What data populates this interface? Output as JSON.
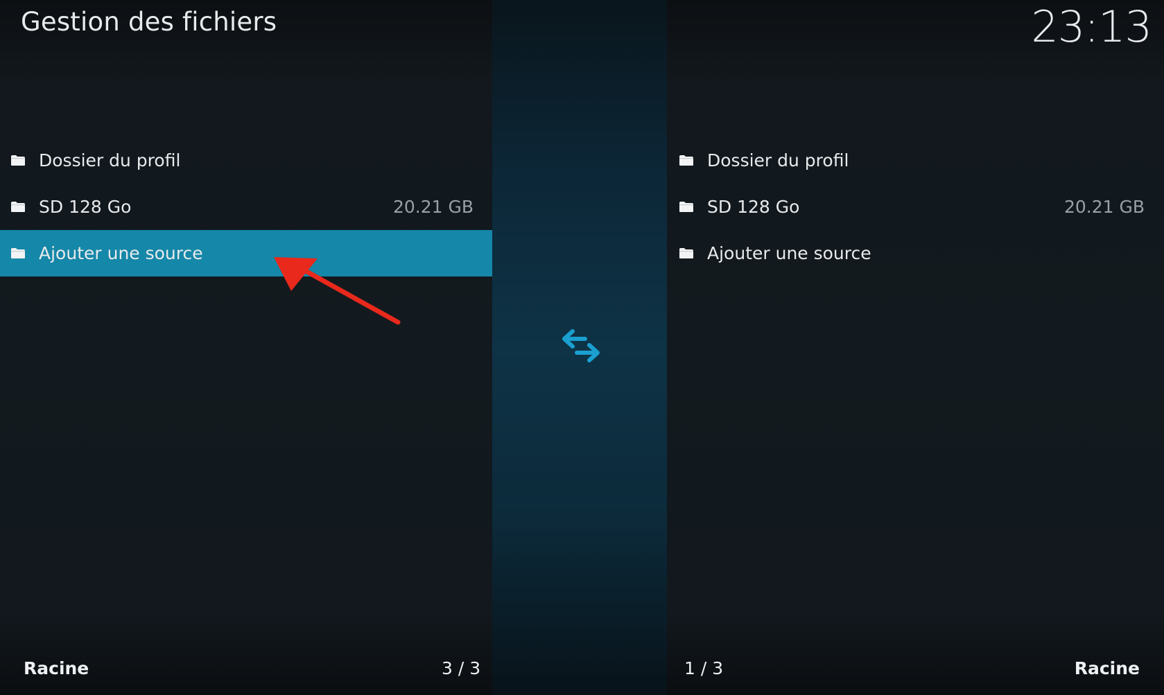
{
  "header": {
    "title": "Gestion des fichiers",
    "clock": "23:13"
  },
  "left_pane": {
    "items": [
      {
        "label": "Dossier du profil",
        "size": "",
        "icon": "folder-icon"
      },
      {
        "label": "SD 128 Go",
        "size": "20.21 GB",
        "icon": "folder-icon"
      },
      {
        "label": "Ajouter une source",
        "size": "",
        "icon": "folder-icon",
        "focused": true
      }
    ],
    "footer_path": "Racine",
    "footer_count": "3 / 3"
  },
  "right_pane": {
    "items": [
      {
        "label": "Dossier du profil",
        "size": "",
        "icon": "folder-icon"
      },
      {
        "label": "SD 128 Go",
        "size": "20.21 GB",
        "icon": "folder-icon"
      },
      {
        "label": "Ajouter une source",
        "size": "",
        "icon": "folder-icon"
      }
    ],
    "footer_path": "Racine",
    "footer_count": "1 / 3"
  },
  "center": {
    "icon": "swap-arrows-icon"
  },
  "colors": {
    "accent": "#1587a8",
    "swap_icon": "#1a9fd0",
    "annotation_arrow": "#e8291c"
  }
}
